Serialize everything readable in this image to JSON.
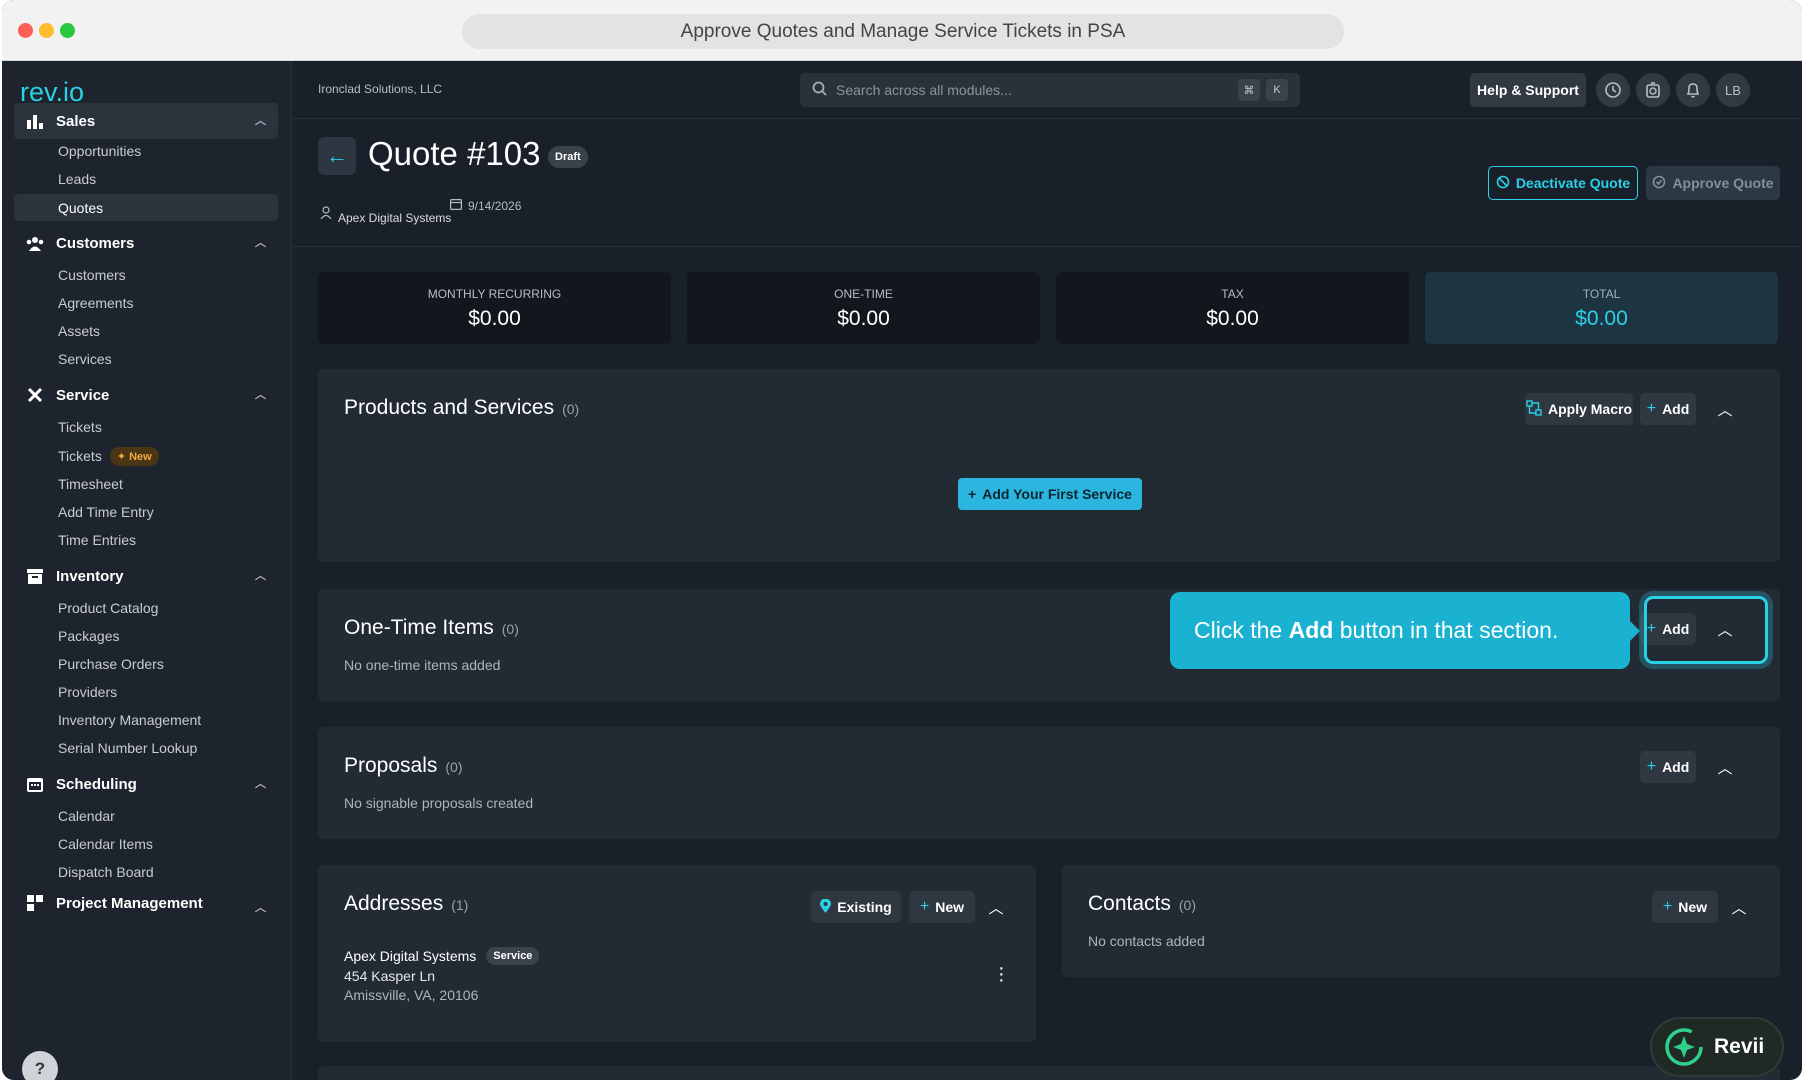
{
  "browser": {
    "title": "Approve Quotes and Manage Service Tickets in PSA"
  },
  "logo": "rev.io",
  "sidebar": {
    "sales": {
      "label": "Sales",
      "items": [
        "Opportunities",
        "Leads",
        "Quotes"
      ]
    },
    "customers": {
      "label": "Customers",
      "items": [
        "Customers",
        "Agreements",
        "Assets",
        "Services"
      ]
    },
    "service": {
      "label": "Service",
      "items": [
        "Tickets",
        "Tickets",
        "Timesheet",
        "Add Time Entry",
        "Time Entries"
      ],
      "new_badge": "New"
    },
    "inventory": {
      "label": "Inventory",
      "items": [
        "Product Catalog",
        "Packages",
        "Purchase Orders",
        "Providers",
        "Inventory Management",
        "Serial Number Lookup"
      ]
    },
    "scheduling": {
      "label": "Scheduling",
      "items": [
        "Calendar",
        "Calendar Items",
        "Dispatch Board"
      ]
    },
    "project": {
      "label": "Project Management"
    },
    "help": "?"
  },
  "topbar": {
    "company": "Ironclad Solutions, LLC",
    "search_placeholder": "Search across all modules...",
    "kbd1": "⌘",
    "kbd2": "K",
    "help_label": "Help & Support",
    "avatar": "LB"
  },
  "quote": {
    "title": "Quote #103",
    "status": "Draft",
    "customer": "Apex Digital Systems",
    "date": "9/14/2026",
    "deactivate_label": "Deactivate Quote",
    "approve_label": "Approve Quote"
  },
  "stats": [
    {
      "label": "MONTHLY RECURRING",
      "value": "$0.00"
    },
    {
      "label": "ONE-TIME",
      "value": "$0.00"
    },
    {
      "label": "TAX",
      "value": "$0.00"
    },
    {
      "label": "TOTAL",
      "value": "$0.00"
    }
  ],
  "products": {
    "title": "Products and Services",
    "count": "(0)",
    "macro_label": "Apply Macro",
    "add_label": "Add",
    "cta_label": "Add Your First Service"
  },
  "onetime": {
    "title": "One-Time Items",
    "count": "(0)",
    "empty": "No one-time items added",
    "add_label": "Add"
  },
  "proposals": {
    "title": "Proposals",
    "count": "(0)",
    "empty": "No signable proposals created",
    "add_label": "Add"
  },
  "addresses": {
    "title": "Addresses",
    "count": "(1)",
    "existing_label": "Existing",
    "new_label": "New",
    "entry": {
      "name": "Apex Digital Systems",
      "badge": "Service",
      "line1": "454 Kasper Ln",
      "line2": "Amissville, VA, 20106"
    }
  },
  "contacts": {
    "title": "Contacts",
    "count": "(0)",
    "empty": "No contacts added",
    "new_label": "New"
  },
  "tooltip": {
    "before": "Click the ",
    "bold": "Add",
    "after": " button in that section."
  },
  "assistant": {
    "label": "Revii"
  },
  "colors": {
    "accent": "#2ad0e6",
    "bg": "#1a2029",
    "card": "#222a34",
    "tooltip": "#1bb2d2",
    "new_badge": "#f0a93a"
  }
}
